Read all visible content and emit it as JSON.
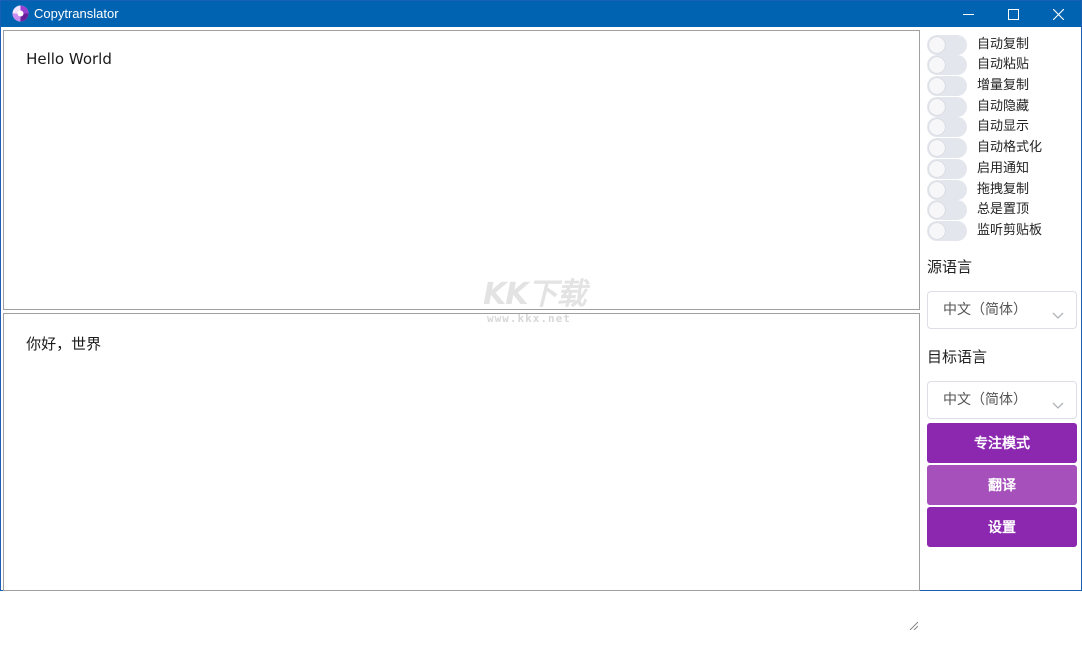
{
  "window": {
    "title": "Copytranslator"
  },
  "source_text": "Hello World",
  "target_text": "你好，世界",
  "watermark": {
    "main": "KK下载",
    "sub": "www.kkx.net"
  },
  "sidebar": {
    "toggles": [
      {
        "label": "自动复制",
        "on": false
      },
      {
        "label": "自动粘贴",
        "on": false
      },
      {
        "label": "增量复制",
        "on": false
      },
      {
        "label": "自动隐藏",
        "on": false
      },
      {
        "label": "自动显示",
        "on": false
      },
      {
        "label": "自动格式化",
        "on": false
      },
      {
        "label": "启用通知",
        "on": false
      },
      {
        "label": "拖拽复制",
        "on": false
      },
      {
        "label": "总是置顶",
        "on": false
      },
      {
        "label": "监听剪贴板",
        "on": false
      }
    ],
    "source_lang_label": "源语言",
    "source_lang_value": "中文（简体）",
    "target_lang_label": "目标语言",
    "target_lang_value": "中文（简体）",
    "buttons": {
      "focus_mode": "专注模式",
      "translate": "翻译",
      "settings": "设置"
    }
  },
  "colors": {
    "titlebar": "#0063b1",
    "button_primary": "#8c27b0",
    "button_secondary": "#a550bb"
  },
  "icons": {
    "app": "copytranslator-logo-icon",
    "minimize": "minimize-icon",
    "maximize": "maximize-icon",
    "close": "close-icon",
    "dropdown": "chevron-down-icon"
  }
}
